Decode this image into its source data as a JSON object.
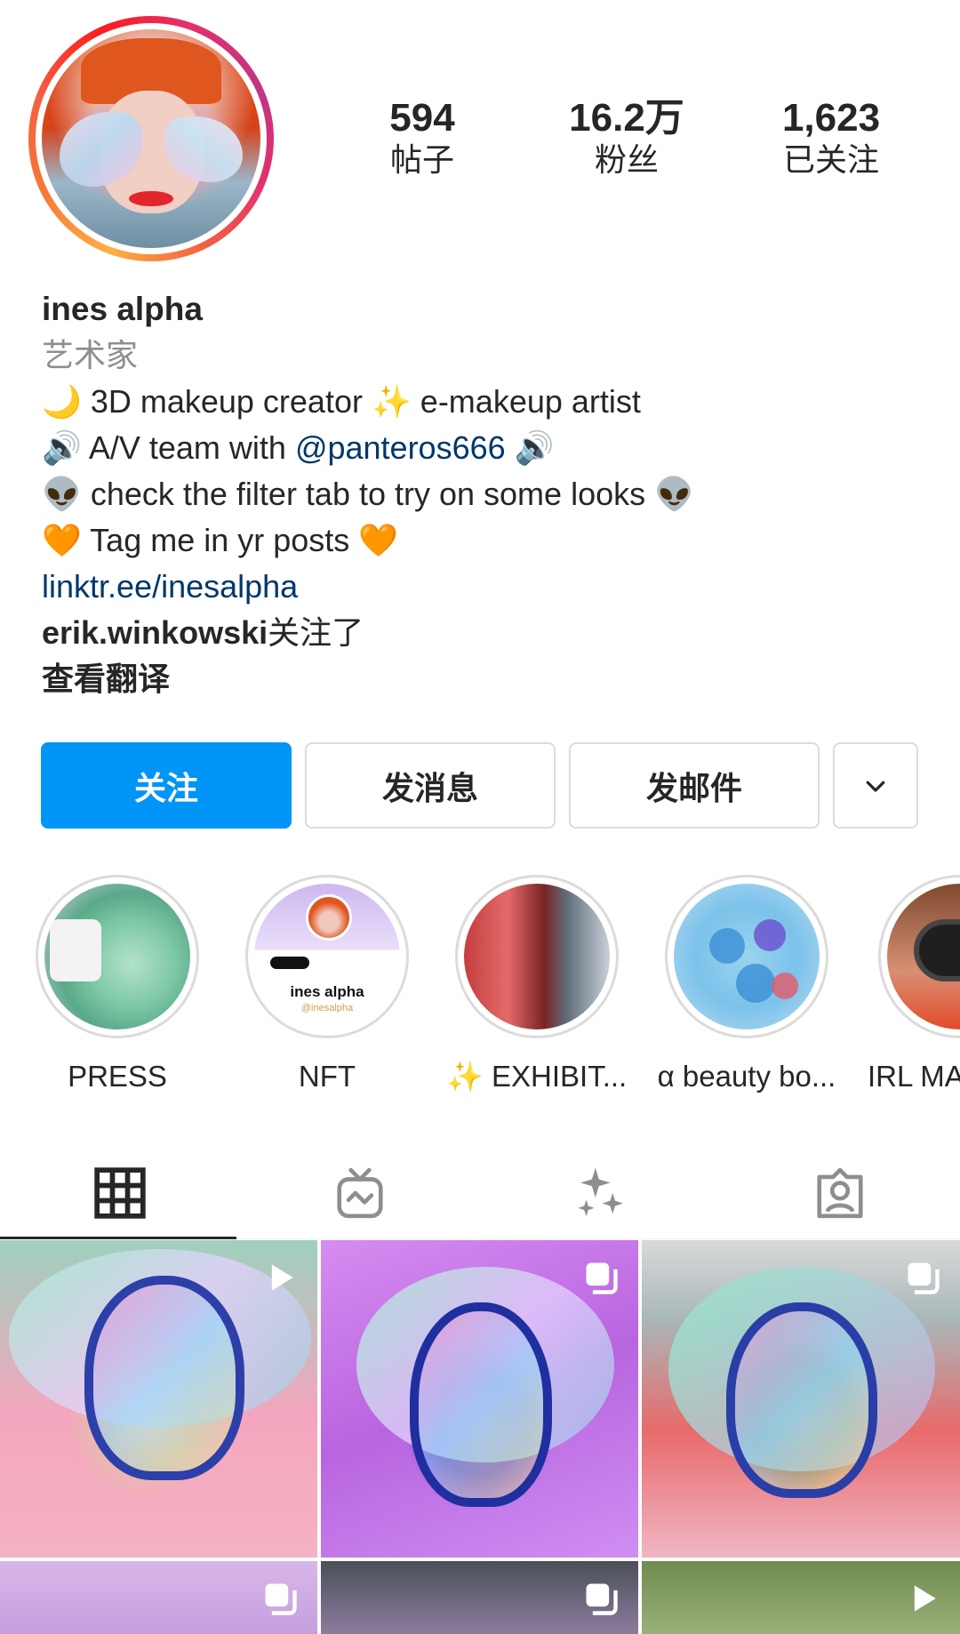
{
  "profile": {
    "stats": [
      {
        "value": "594",
        "label": "帖子"
      },
      {
        "value": "16.2万",
        "label": "粉丝"
      },
      {
        "value": "1,623",
        "label": "已关注"
      }
    ],
    "name": "ines alpha",
    "category": "艺术家",
    "bio": {
      "line1": "🌙 3D makeup creator ✨ e-makeup artist",
      "line2_pre": "🔊 A/V team with ",
      "line2_mention": "@panteros666",
      "line2_post": " 🔊",
      "line3": "👽 check the filter tab to try on some looks 👽",
      "line4": "🧡 Tag me in yr posts 🧡"
    },
    "link": "linktr.ee/inesalpha",
    "followed_by_user": "erik.winkowski",
    "followed_by_suffix": "关注了",
    "see_translation": "查看翻译"
  },
  "actions": {
    "follow": "关注",
    "message": "发消息",
    "email": "发邮件"
  },
  "highlights": [
    {
      "label": "PRESS"
    },
    {
      "label": "NFT",
      "card_name": "ines alpha",
      "card_handle": "@inesalpha"
    },
    {
      "label": "✨ EXHIBIT..."
    },
    {
      "label": "α beauty bo..."
    },
    {
      "label": "IRL MA"
    }
  ],
  "tabs": [
    {
      "icon": "grid-icon",
      "active": true
    },
    {
      "icon": "igtv-icon",
      "active": false
    },
    {
      "icon": "effects-sparkle-icon",
      "active": false
    },
    {
      "icon": "tagged-icon",
      "active": false
    }
  ],
  "grid": [
    {
      "type": "reel",
      "icon": "reel-play-icon"
    },
    {
      "type": "carousel",
      "icon": "carousel-icon"
    },
    {
      "type": "carousel",
      "icon": "carousel-icon"
    },
    {
      "type": "carousel",
      "icon": "carousel-icon"
    },
    {
      "type": "carousel",
      "icon": "carousel-icon"
    },
    {
      "type": "reel",
      "icon": "reel-play-icon"
    }
  ],
  "colors": {
    "accent": "#0095f6",
    "link": "#00376b",
    "muted": "#8e8e8e",
    "text": "#262626"
  }
}
